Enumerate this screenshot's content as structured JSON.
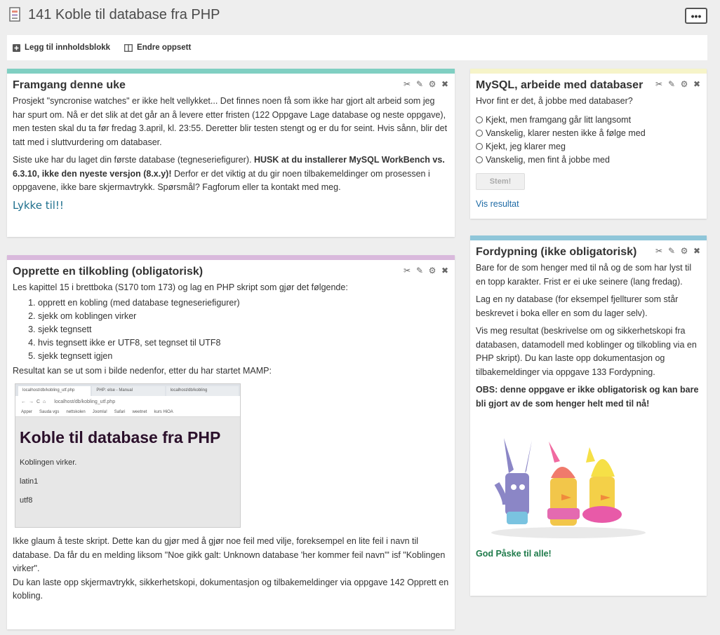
{
  "page": {
    "title": "141 Koble til database fra PHP",
    "menu_label": "•••"
  },
  "toolbar": {
    "add_block": "Legg til innholdsblokk",
    "change_layout": "Endre oppsett"
  },
  "colors": {
    "green": "#80cfc2",
    "yellow": "#f6f4c9",
    "purple": "#d9b9dc",
    "blue": "#8fc6d9"
  },
  "framgang": {
    "title": "Framgang denne uke",
    "p1": "Prosjekt \"syncronise watches\" er ikke helt vellykket... Det finnes noen få som ikke har gjort alt arbeid som jeg har spurt om. Nå er det slik at det går an å levere etter fristen (122 Oppgave Lage database og neste oppgave), men testen skal du ta før fredag 3.april, kl. 23:55. Deretter blir testen stengt og er du for seint. Hvis sånn, blir det tatt med i sluttvurdering om databaser.",
    "p2a": "Siste uke har du laget din første database (tegneseriefigurer). ",
    "p2b": "HUSK at du installerer MySQL WorkBench vs. 6.3.10, ikke den nyeste versjon (8.x.y)!",
    "p2c": "  Derfor er det viktig at du gir noen tilbakemeldinger om prosessen i oppgavene, ikke bare skjermavtrykk. Spørsmål? Fagforum eller ta kontakt med meg.",
    "lykke": "Lykke til!!"
  },
  "opprette": {
    "title": "Opprette en tilkobling (obligatorisk)",
    "intro": "Les kapittel 15 i brettboka (S170 tom 173) og lag en PHP skript som gjør det følgende:",
    "steps": [
      "opprett en kobling (med database tegneseriefigurer)",
      "sjekk om koblingen virker",
      "sjekk tegnsett",
      "hvis tegnsett ikke er UTF8, set tegnset til UTF8",
      "sjekk tegnsett igjen"
    ],
    "result": "Resultat kan se ut som i bilde nedenfor, etter du har startet MAMP:",
    "shot": {
      "tab1": "localhost/db/kobling_utf.php",
      "tab2": "PHP: else - Manual",
      "tab3": "localhost/db/kobling",
      "address": "localhost/db/kobling_utf.php",
      "bookmarks": [
        "Apper",
        "Sauda vgs",
        "nettskolen",
        "Joomla!",
        "Safari",
        "weetnet",
        "kurs HiOA"
      ],
      "heading": "Koble til database fra PHP",
      "line1": "Koblingen virker.",
      "line2": "latin1",
      "line3": "utf8"
    },
    "p3": "Ikke glaum å teste skript. Dette kan du gjør med å gjør noe feil med vilje, foreksempel en lite feil i navn til database. Da får du en melding liksom \"Noe gikk galt: Unknown database 'her kommer feil navn'\" isf \"Koblingen virker\".",
    "p4": "Du kan laste opp skjermavtrykk, sikkerhetskopi, dokumentasjon og tilbakemeldinger via oppgave 142 Opprett en kobling."
  },
  "mysql": {
    "title": "MySQL, arbeide med databaser",
    "question": "Hvor fint er det, å jobbe med databaser?",
    "options": [
      "Kjekt, men framgang går litt langsomt",
      "Vanskelig, klarer nesten ikke å følge med",
      "Kjekt, jeg klarer meg",
      "Vanskelig, men fint å jobbe med"
    ],
    "vote": "Stem!",
    "results_link": "Vis resultat"
  },
  "fordypning": {
    "title": "Fordypning (ikke obligatorisk)",
    "p1": "Bare for de som henger med til nå og de som har lyst til en topp karakter. Frist er ei uke seinere (lang fredag).",
    "p2": "Lag en ny database (for eksempel fjellturer som står beskrevet i boka eller en som du lager selv).",
    "p3": "Vis meg resultat (beskrivelse om og sikkerhetskopi fra databasen, datamodell med koblinger og tilkobling via en PHP skript). Du kan laste opp dokumentasjon og tilbakemeldinger via oppgave 133 Fordypning.",
    "obs": "OBS: denne oppgave er ikke obligatorisk og kan bare bli gjort av de som henger helt med til nå!",
    "easter": "God Påske til alle!"
  }
}
